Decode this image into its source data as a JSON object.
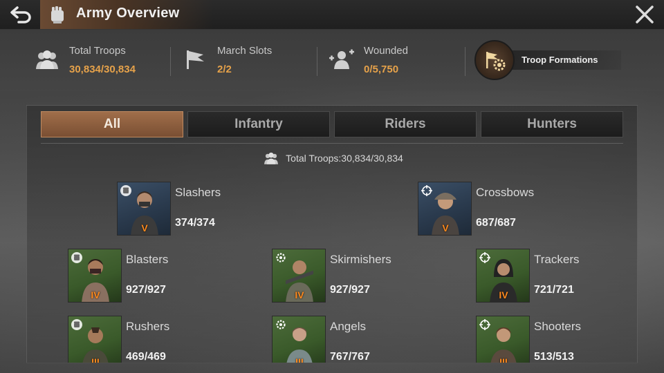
{
  "header": {
    "title": "Army Overview"
  },
  "stats": [
    {
      "label": "Total Troops",
      "value": "30,834/30,834",
      "icon": "troops-icon"
    },
    {
      "label": "March Slots",
      "value": "2/2",
      "icon": "flag-icon"
    },
    {
      "label": "Wounded",
      "value": "0/5,750",
      "icon": "wounded-icon"
    }
  ],
  "formations": {
    "label": "Troop Formations",
    "icon": "formation-gear-icon"
  },
  "tabs": [
    {
      "label": "All",
      "active": true
    },
    {
      "label": "Infantry",
      "active": false
    },
    {
      "label": "Riders",
      "active": false
    },
    {
      "label": "Hunters",
      "active": false
    }
  ],
  "total_line": "Total Troops:30,834/30,834",
  "troops": [
    {
      "name": "Slashers",
      "count": "374/374",
      "tier": "V",
      "badge": "fist-icon"
    },
    {
      "name": "Crossbows",
      "count": "687/687",
      "tier": "V",
      "badge": "crosshair-icon"
    },
    {
      "name": "Blasters",
      "count": "927/927",
      "tier": "IV",
      "badge": "fist-icon"
    },
    {
      "name": "Skirmishers",
      "count": "927/927",
      "tier": "IV",
      "badge": "gear-icon"
    },
    {
      "name": "Trackers",
      "count": "721/721",
      "tier": "IV",
      "badge": "crosshair-icon"
    },
    {
      "name": "Rushers",
      "count": "469/469",
      "tier": "III",
      "badge": "fist-icon"
    },
    {
      "name": "Angels",
      "count": "767/767",
      "tier": "III",
      "badge": "gear-icon"
    },
    {
      "name": "Shooters",
      "count": "513/513",
      "tier": "III",
      "badge": "crosshair-icon"
    }
  ],
  "colors": {
    "accent_value": "#e6a24a",
    "tier": "#ff8a1e",
    "active_tab": "#a06e4a"
  }
}
